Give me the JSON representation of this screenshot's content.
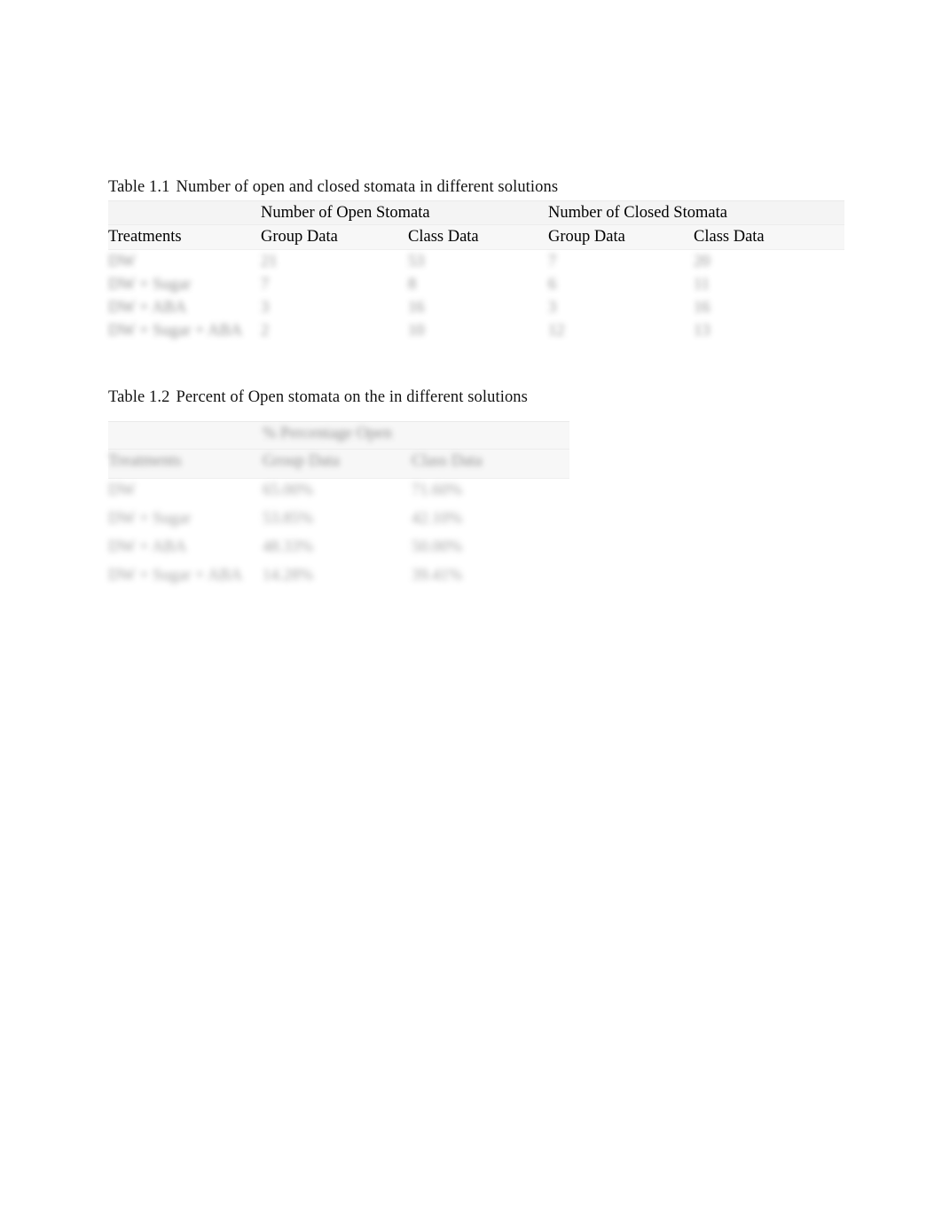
{
  "document": {
    "background_color": "#ffffff",
    "text_color": "#121212"
  },
  "table_1": {
    "caption_label": "Table 1.1",
    "caption_text": "Number of open and closed stomata in different solutions",
    "group_headers": [
      {
        "label": "",
        "span": 1
      },
      {
        "label": "Number of Open Stomata",
        "span": 2
      },
      {
        "label": "Number of Closed Stomata",
        "span": 2
      }
    ],
    "column_headers": [
      "Treatments",
      "Group Data",
      "Class Data",
      "Group Data",
      "Class Data"
    ],
    "redacted": true,
    "rows": [
      {
        "treatment": "DW",
        "open_group": "21",
        "open_class": "53",
        "closed_group": "7",
        "closed_class": "20"
      },
      {
        "treatment": "DW + Sugar",
        "open_group": "7",
        "open_class": "8",
        "closed_group": "6",
        "closed_class": "11"
      },
      {
        "treatment": "DW + ABA",
        "open_group": "3",
        "open_class": "16",
        "closed_group": "3",
        "closed_class": "16"
      },
      {
        "treatment": "DW + Sugar + ABA",
        "open_group": "2",
        "open_class": "10",
        "closed_group": "12",
        "closed_class": "13"
      }
    ]
  },
  "table_2": {
    "caption_label": "Table 1.2",
    "caption_text": "Percent of Open stomata on the in different solutions",
    "group_headers": [
      {
        "label": "",
        "span": 1
      },
      {
        "label": "% Percentage Open",
        "span": 2
      }
    ],
    "column_headers": [
      "Treatments",
      "Group Data",
      "Class Data"
    ],
    "redacted": true,
    "rows": [
      {
        "treatment": "DW",
        "group_data": "65.00%",
        "class_data": "71.60%"
      },
      {
        "treatment": "DW + Sugar",
        "group_data": "53.85%",
        "class_data": "42.10%"
      },
      {
        "treatment": "DW + ABA",
        "group_data": "48.33%",
        "class_data": "50.00%"
      },
      {
        "treatment": "DW + Sugar + ABA",
        "group_data": "14.28%",
        "class_data": "39.41%"
      }
    ]
  }
}
